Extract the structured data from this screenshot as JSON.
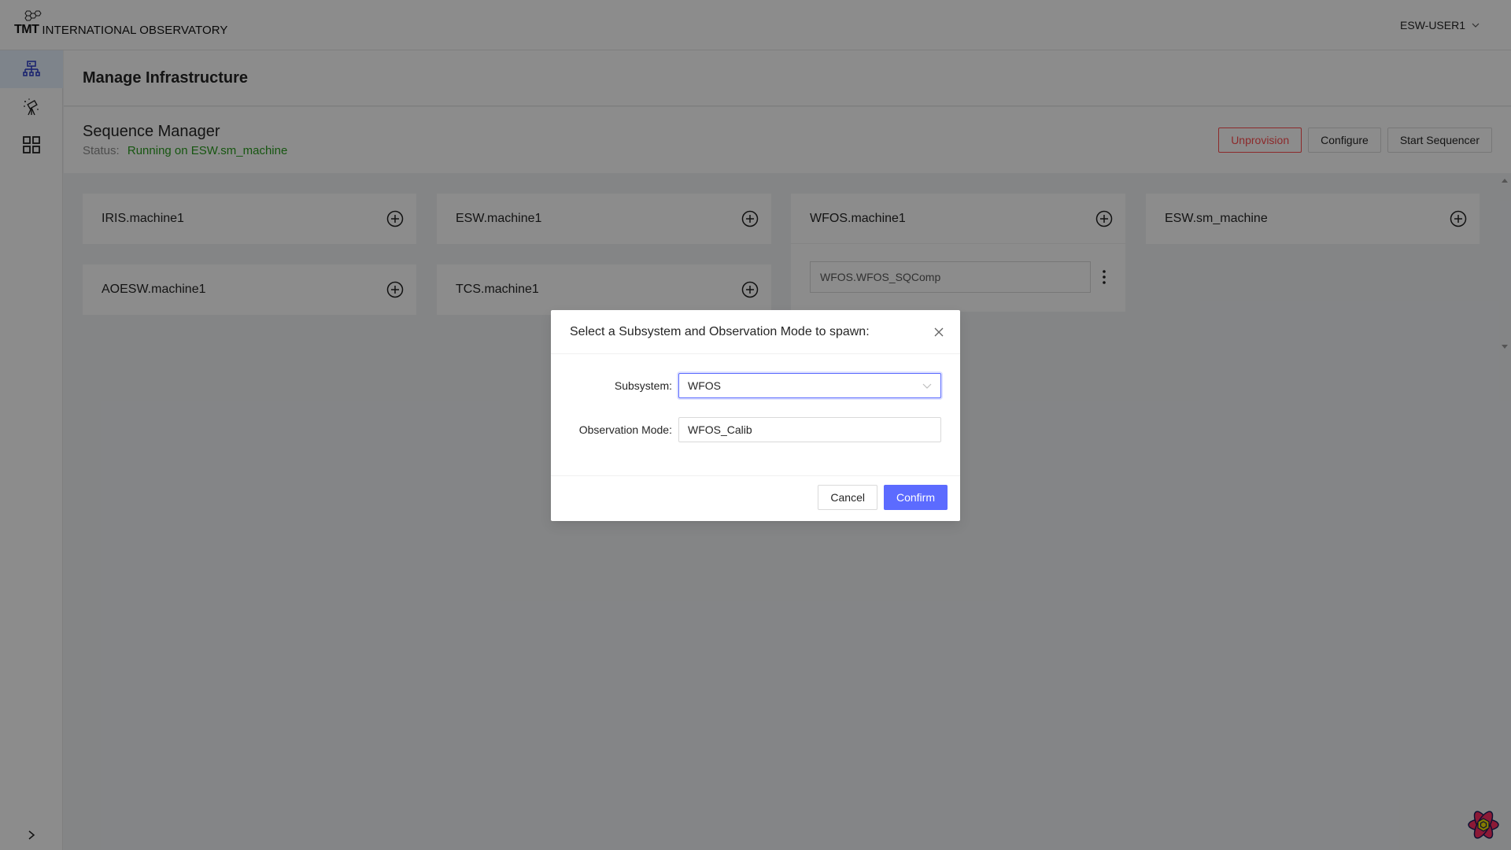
{
  "header": {
    "logo_mark": "TMT",
    "logo_text": "INTERNATIONAL OBSERVATORY",
    "user": "ESW-USER1",
    "user_icon": "chevron-down-icon"
  },
  "sidebar": {
    "items": [
      {
        "name": "infrastructure",
        "icon": "sitemap-icon",
        "active": true
      },
      {
        "name": "observations",
        "icon": "telescope-icon",
        "active": false
      },
      {
        "name": "resources",
        "icon": "grid-icon",
        "active": false
      }
    ],
    "collapse_icon": "chevron-right-icon"
  },
  "page": {
    "title": "Manage Infrastructure"
  },
  "sequence_manager": {
    "title": "Sequence Manager",
    "status_label": "Status:",
    "status_value": "Running on ESW.sm_machine",
    "status_color": "#2a9d1f",
    "actions": {
      "unprovision": "Unprovision",
      "configure": "Configure",
      "start_sequencer": "Start Sequencer"
    }
  },
  "machines": [
    {
      "name": "IRIS.machine1",
      "sequencers": []
    },
    {
      "name": "ESW.machine1",
      "sequencers": []
    },
    {
      "name": "WFOS.machine1",
      "sequencers": [
        "WFOS.WFOS_SQComp"
      ]
    },
    {
      "name": "ESW.sm_machine",
      "sequencers": []
    },
    {
      "name": "AOESW.machine1",
      "sequencers": []
    },
    {
      "name": "TCS.machine1",
      "sequencers": []
    }
  ],
  "modal": {
    "title": "Select a Subsystem and Observation Mode to spawn:",
    "subsystem_label": "Subsystem",
    "subsystem_value": "WFOS",
    "obs_mode_label": "Observation Mode",
    "obs_mode_value": "WFOS_Calib",
    "cancel": "Cancel",
    "confirm": "Confirm"
  },
  "colors": {
    "primary": "#5c6bff",
    "danger": "#ff4d4f",
    "success": "#2a9d1f"
  }
}
